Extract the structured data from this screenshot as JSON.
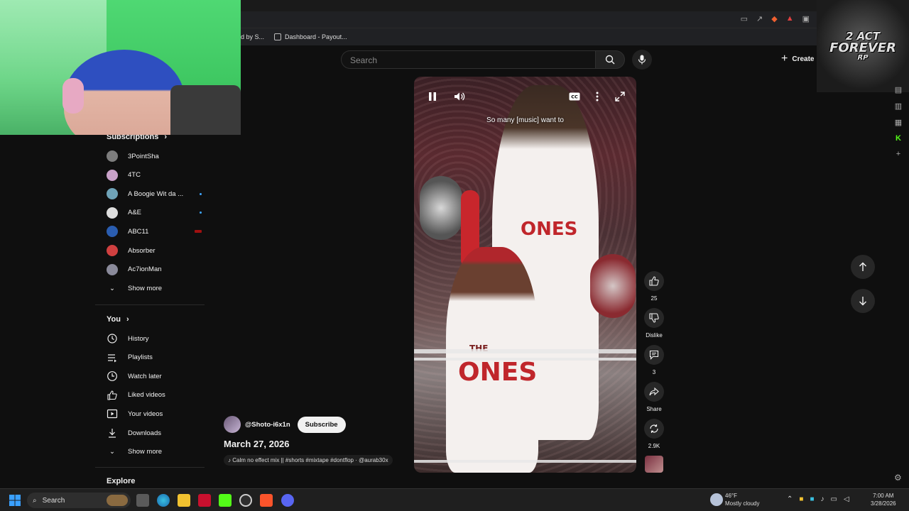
{
  "browser": {
    "bookmarks": [
      {
        "label": "ed by S..."
      },
      {
        "label": "Dashboard - Payout..."
      }
    ]
  },
  "header": {
    "search_placeholder": "Search",
    "create_label": "Create"
  },
  "sidebar": {
    "subscriptions_label": "Subscriptions",
    "subscriptions": [
      {
        "name": "3PointSha",
        "indicator": "none",
        "color": "#7d7d7d"
      },
      {
        "name": "4TC",
        "indicator": "none",
        "color": "#c9a2c9"
      },
      {
        "name": "A Boogie Wit da ...",
        "indicator": "dot",
        "color": "#6fa3b8"
      },
      {
        "name": "A&E",
        "indicator": "dot",
        "color": "#dddddd"
      },
      {
        "name": "ABC11",
        "indicator": "live",
        "color": "#2a5db0"
      },
      {
        "name": "Absorber",
        "indicator": "none",
        "color": "#d04040"
      },
      {
        "name": "Ac7ionMan",
        "indicator": "none",
        "color": "#8a8a9a"
      }
    ],
    "show_more_1": "Show more",
    "you_label": "You",
    "you_items": [
      {
        "label": "History",
        "icon": "history-icon"
      },
      {
        "label": "Playlists",
        "icon": "playlists-icon"
      },
      {
        "label": "Watch later",
        "icon": "watch-later-icon"
      },
      {
        "label": "Liked videos",
        "icon": "liked-videos-icon"
      },
      {
        "label": "Your videos",
        "icon": "your-videos-icon"
      },
      {
        "label": "Downloads",
        "icon": "downloads-icon"
      }
    ],
    "show_more_2": "Show more",
    "explore_label": "Explore"
  },
  "video": {
    "caption": "So many [music] want to",
    "shirt_top": "ONES",
    "shirt_bottom": "ONES",
    "shirt_the": "THE"
  },
  "actions": {
    "like_count": "25",
    "dislike_label": "Dislike",
    "comment_count": "3",
    "share_label": "Share",
    "remix_count": "2.9K"
  },
  "channel": {
    "handle": "@Shoto-i6x1n",
    "subscribe_label": "Subscribe",
    "date": "March 27, 2026",
    "sound": "Calm no effect mix || #shorts #mixtape #dontflop · @aurab30x"
  },
  "overlay": {
    "logo_lines": [
      "2 ACT",
      "FOREVER",
      "RP"
    ]
  },
  "taskbar": {
    "search_label": "Search",
    "temperature": "46°F",
    "weather": "Mostly cloudy",
    "time": "7:00 AM",
    "date": "3/28/2026"
  },
  "colors": {
    "accent_blue": "#3ea6ff",
    "background": "#0f0f0f",
    "subscribe_bg": "#f1f1f1",
    "green_screen": "#45d06a"
  }
}
